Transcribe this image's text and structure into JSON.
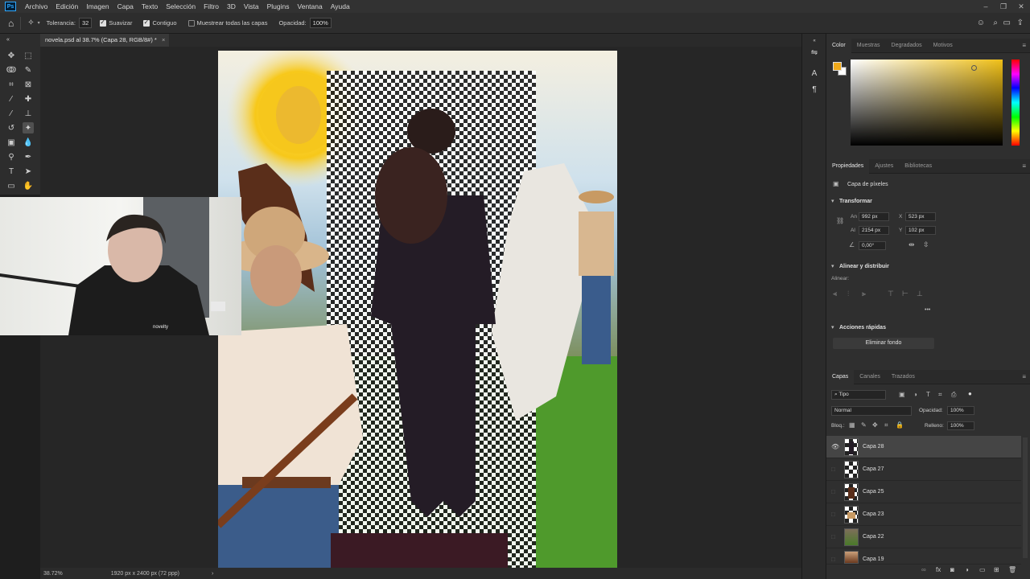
{
  "menu": {
    "app_logo": "Ps",
    "items": [
      "Archivo",
      "Edición",
      "Imagen",
      "Capa",
      "Texto",
      "Selección",
      "Filtro",
      "3D",
      "Vista",
      "Plugins",
      "Ventana",
      "Ayuda"
    ]
  },
  "options_bar": {
    "tolerance_label": "Tolerancia:",
    "tolerance_value": "32",
    "antialias_label": "Suavizar",
    "contiguous_label": "Contiguo",
    "sample_all_label": "Muestrear todas las capas",
    "opacity_label": "Opacidad:",
    "opacity_value": "100%"
  },
  "document": {
    "tab_title": "novela.psd al 38.7% (Capa 28, RGB/8#) *",
    "close_symbol": "×"
  },
  "status": {
    "zoom": "38.72%",
    "size": "1920 px x 2400 px (72 ppp)",
    "arrow": "›"
  },
  "color_panel": {
    "tabs": [
      "Color",
      "Muestras",
      "Degradados",
      "Motivos"
    ],
    "foreground": "#f0a91a",
    "background": "#ffffff",
    "hue_color": "#f0c018"
  },
  "properties": {
    "tabs": [
      "Propiedades",
      "Ajustes",
      "Bibliotecas"
    ],
    "layer_type": "Capa de píxeles",
    "transform_title": "Transformar",
    "w_label": "An",
    "w_value": "992 px",
    "h_label": "Al",
    "h_value": "2154 px",
    "x_label": "X",
    "x_value": "523 px",
    "y_label": "Y",
    "y_value": "102 px",
    "angle_value": "0,00°",
    "align_title": "Alinear y distribuir",
    "align_sub": "Alinear:",
    "more": "•••",
    "quick_title": "Acciones rápidas",
    "remove_bg": "Eliminar fondo"
  },
  "layers_panel": {
    "tabs": [
      "Capas",
      "Canales",
      "Trazados"
    ],
    "filter_label": "Tipo",
    "blend_mode": "Normal",
    "opacity_label": "Opacidad:",
    "opacity_value": "100%",
    "lock_label": "Bloq.:",
    "fill_label": "Relleno:",
    "fill_value": "100%",
    "layers": [
      {
        "name": "Capa 28",
        "visible": true,
        "selected": true
      },
      {
        "name": "Capa 27",
        "visible": false,
        "selected": false
      },
      {
        "name": "Capa 25",
        "visible": false,
        "selected": false
      },
      {
        "name": "Capa 23",
        "visible": false,
        "selected": false
      },
      {
        "name": "Capa 22",
        "visible": false,
        "selected": false
      },
      {
        "name": "Capa 19",
        "visible": false,
        "selected": false
      }
    ]
  },
  "webcam": {
    "hoodie_text": "novelty"
  }
}
